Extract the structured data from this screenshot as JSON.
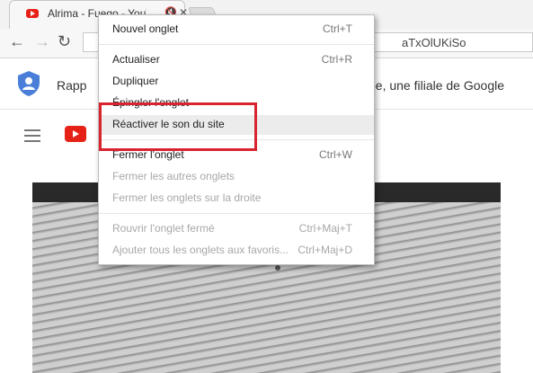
{
  "browser": {
    "tab": {
      "title": "Alrima - Fuego - YouT",
      "mute_icon": "muted-speaker-icon",
      "close_icon": "close-icon"
    },
    "url": "aTxOlUKiSo",
    "nav_icons": [
      "back-arrow-icon",
      "forward-arrow-icon",
      "reload-icon"
    ]
  },
  "banner": {
    "left_text": "Rapp",
    "right_text": "be, une filiale de Google",
    "icon": "google-account-shield-icon"
  },
  "youtube": {
    "menu_icon": "hamburger-icon",
    "logo": "youtube-logo"
  },
  "context_menu": {
    "items": [
      {
        "label": "Nouvel onglet",
        "shortcut": "Ctrl+T",
        "enabled": true
      },
      {
        "label": "Actualiser",
        "shortcut": "Ctrl+R",
        "enabled": true
      },
      {
        "label": "Dupliquer",
        "shortcut": "",
        "enabled": true
      },
      {
        "label": "Épingler l'onglet",
        "shortcut": "",
        "enabled": true
      },
      {
        "label": "Réactiver le son du site",
        "shortcut": "",
        "enabled": true,
        "highlighted": true
      },
      {
        "label": "Fermer l'onglet",
        "shortcut": "Ctrl+W",
        "enabled": true
      },
      {
        "label": "Fermer les autres onglets",
        "shortcut": "",
        "enabled": false
      },
      {
        "label": "Fermer les onglets sur la droite",
        "shortcut": "",
        "enabled": false
      },
      {
        "label": "Rouvrir l'onglet fermé",
        "shortcut": "Ctrl+Maj+T",
        "enabled": false
      },
      {
        "label": "Ajouter tous les onglets aux favoris...",
        "shortcut": "Ctrl+Maj+D",
        "enabled": false
      }
    ]
  },
  "colors": {
    "highlight_box": "#d9232f",
    "youtube_red": "#e62117",
    "menu_disabled": "#a8a8a8"
  }
}
